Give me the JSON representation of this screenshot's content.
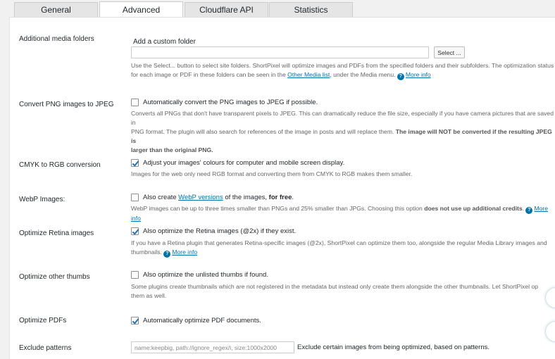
{
  "tabs": [
    {
      "label": "General"
    },
    {
      "label": "Advanced"
    },
    {
      "label": "Cloudflare API"
    },
    {
      "label": "Statistics"
    }
  ],
  "media_folders": {
    "label": "Additional media folders",
    "sublabel": "Add a custom folder",
    "input_value": "",
    "select_button": "Select ...",
    "desc_1": "Use the Select... button to select site folders. ShortPixel will optimize images and PDFs from the specified folders and their subfolders. The optimization status",
    "desc_2a": "for each image or PDF in these folders can be seen in the ",
    "desc_link": "Other Media list",
    "desc_2b": ", under the Media menu.",
    "more_info": "More info"
  },
  "png_to_jpeg": {
    "label": "Convert PNG images to JPEG",
    "checkbox_label": "Automatically convert the PNG images to JPEG if possible.",
    "desc_1": "Converts all PNGs that don't have transparent pixels to JPEG. This can dramatically reduce the file size, especially if you have camera pictures that are saved in",
    "desc_2a": "PNG format. The plugin will also search for references of the image in posts and will replace them. ",
    "desc_2b_bold": "The image will NOT be converted if the resulting JPEG is",
    "desc_3_bold": "larger than the original PNG."
  },
  "cmyk": {
    "label": "CMYK to RGB conversion",
    "checkbox_label": "Adjust your images' colours for computer and mobile screen display.",
    "desc": "Images for the web only need RGB format and converting them from CMYK to RGB makes them smaller."
  },
  "webp": {
    "label": "WebP Images:",
    "checkbox_a": "Also create ",
    "checkbox_link": "WebP versions",
    "checkbox_b": " of the images, ",
    "checkbox_bold": "for free",
    "checkbox_c": ".",
    "desc_a": "WebP images can be up to three times smaller than PNGs and 25% smaller than JPGs. Choosing this option ",
    "desc_bold": "does not use up additional credits",
    "desc_b": ".",
    "more_info": "More info"
  },
  "retina": {
    "label": "Optimize Retina images",
    "checkbox_label": "Also optimize the Retina images (@2x) if they exist.",
    "desc_1": "If you have a Retina plugin that generates Retina-specific images (@2x), ShortPixel can optimize them too, alongside the regular Media Library images and",
    "desc_2": "thumbnails.",
    "more_info": "More info"
  },
  "other_thumbs": {
    "label": "Optimize other thumbs",
    "checkbox_label": "Also optimize the unlisted thumbs if found.",
    "desc_1": "Some plugins create thumbnails which are not registered in the metadata but instead only create them alongside the other thumbnails. Let ShortPixel op",
    "desc_2": "them as well."
  },
  "pdfs": {
    "label": "Optimize PDFs",
    "checkbox_label": "Automatically optimize PDF documents."
  },
  "exclude": {
    "label": "Exclude patterns",
    "input_value": "name:keepbig, path://ignore_regex/i, size:1000x2000",
    "desc": "Exclude certain images from being optimized, based on patterns."
  },
  "checkbox_states": {
    "png_to_jpeg": false,
    "cmyk": true,
    "webp": false,
    "retina": true,
    "other_thumbs": false,
    "pdfs": true
  },
  "colors": {
    "link": "#0073aa",
    "checkmark": "#2271b1"
  }
}
